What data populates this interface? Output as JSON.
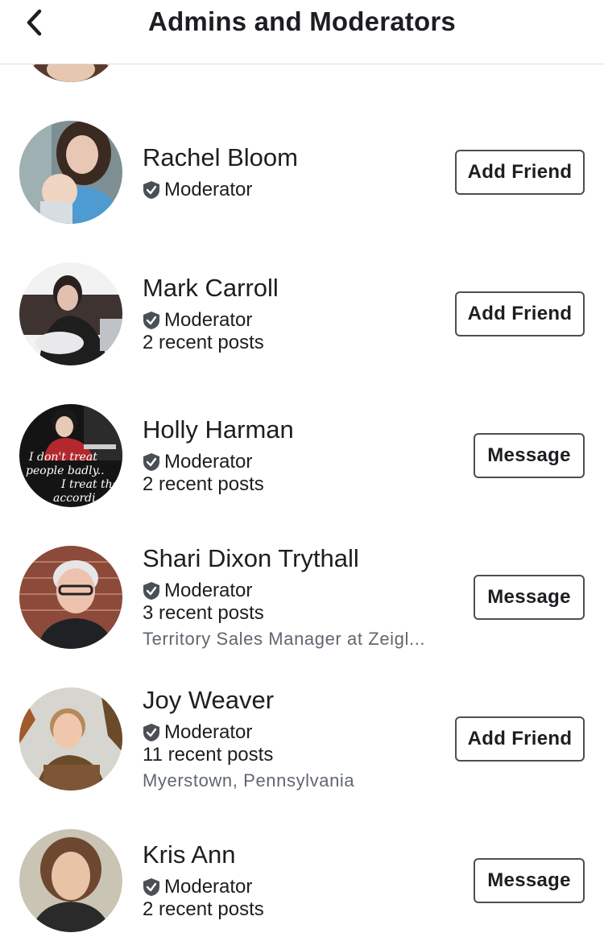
{
  "header": {
    "title": "Admins and Moderators"
  },
  "members": [
    {
      "name": "Rachel Bloom",
      "role": "Moderator",
      "posts": "",
      "detail": "",
      "action": "Add Friend",
      "kind": "add"
    },
    {
      "name": "Mark Carroll",
      "role": "Moderator",
      "posts": "2 recent posts",
      "detail": "",
      "action": "Add Friend",
      "kind": "add"
    },
    {
      "name": "Holly Harman",
      "role": "Moderator",
      "posts": "2 recent posts",
      "detail": "",
      "action": "Message",
      "kind": "msg",
      "avatar_text": [
        "I don't treat",
        "people badly..",
        "I treat the",
        "accordi"
      ]
    },
    {
      "name": "Shari Dixon Trythall",
      "role": "Moderator",
      "posts": "3 recent posts",
      "detail": "Territory Sales Manager at Zeigl...",
      "action": "Message",
      "kind": "msg"
    },
    {
      "name": "Joy Weaver",
      "role": "Moderator",
      "posts": "11 recent posts",
      "detail": "Myerstown, Pennsylvania",
      "action": "Add Friend",
      "kind": "add"
    },
    {
      "name": "Kris Ann",
      "role": "Moderator",
      "posts": "2 recent posts",
      "detail": "",
      "action": "Message",
      "kind": "msg"
    }
  ],
  "colors": {
    "border": "#4b4f56",
    "secondary_text": "#606770",
    "divider": "#dadde1"
  }
}
